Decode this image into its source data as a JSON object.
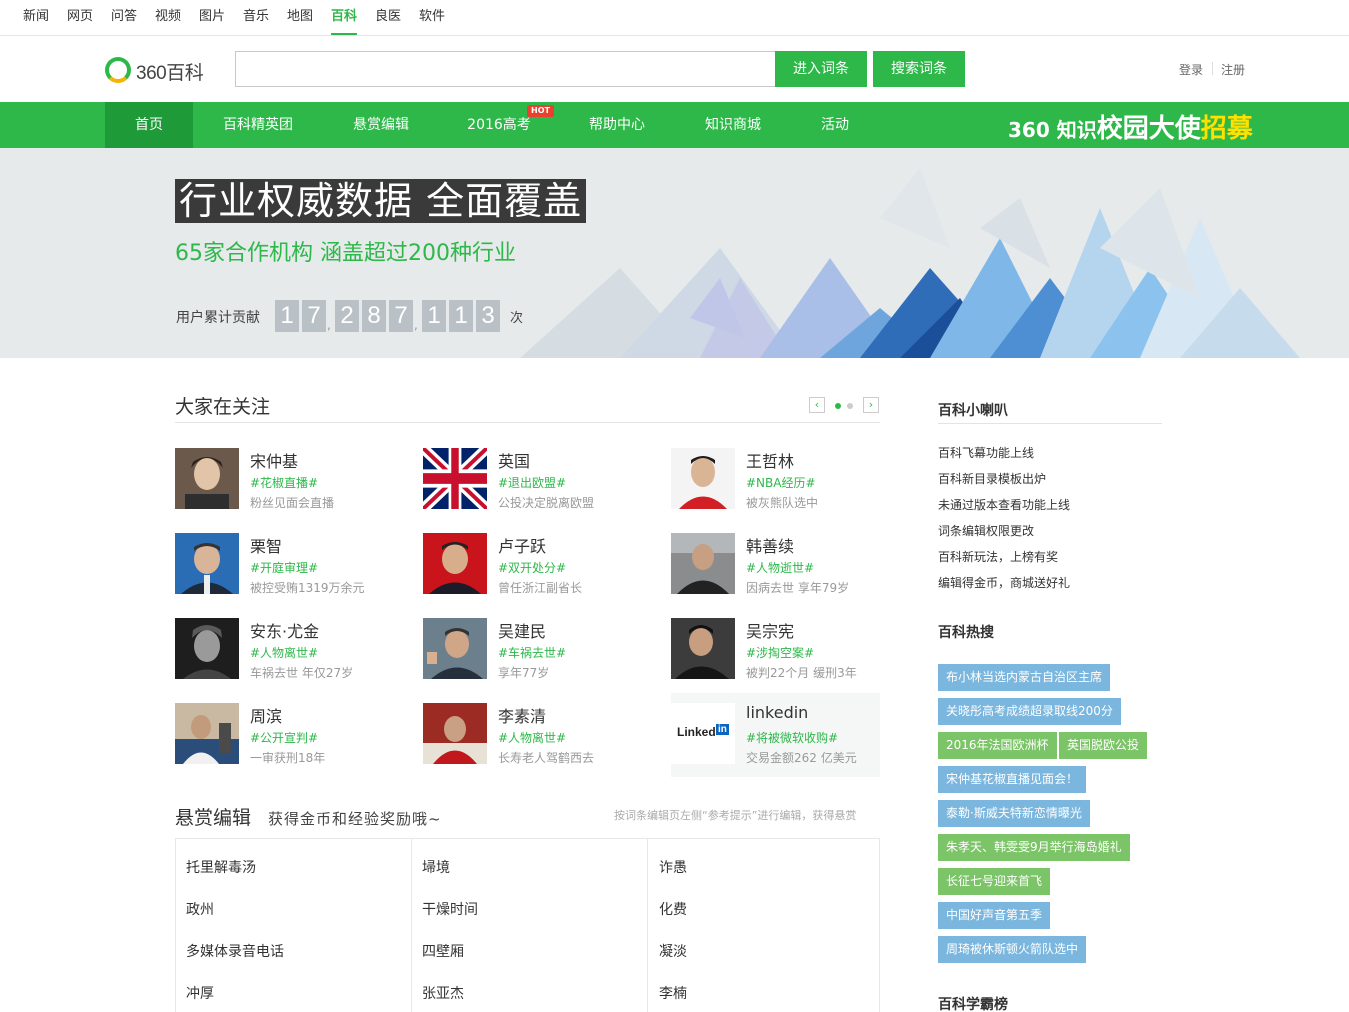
{
  "topnav": {
    "items": [
      "新闻",
      "网页",
      "问答",
      "视频",
      "图片",
      "音乐",
      "地图",
      "百科",
      "良医",
      "软件"
    ],
    "active": "百科"
  },
  "header": {
    "logo_text": "360百科",
    "search_value": "",
    "enter_button": "进入词条",
    "search_button": "搜索词条",
    "login": "登录",
    "register": "注册"
  },
  "mainnav": {
    "items": [
      "首页",
      "百科精英团",
      "悬赏编辑",
      "2016高考",
      "帮助中心",
      "知识商城",
      "活动"
    ],
    "hot_badge": "HOT",
    "promo_part1": "360 知识",
    "promo_part2": "校园大使",
    "promo_part3": "招募"
  },
  "banner": {
    "headline": "行业权威数据 全面覆盖",
    "subline": "65家合作机构  涵盖超过200种行业",
    "contrib_label": "用户累计贡献",
    "digits": [
      "1",
      "7",
      "2",
      "8",
      "7",
      "1",
      "1",
      "3"
    ],
    "times_label": "次"
  },
  "focus": {
    "title": "大家在关注",
    "people": [
      {
        "name": "宋仲基",
        "tag": "#花椒直播#",
        "desc": "粉丝见面会直播"
      },
      {
        "name": "英国",
        "tag": "#退出欧盟#",
        "desc": "公投决定脱离欧盟"
      },
      {
        "name": "王哲林",
        "tag": "#NBA经历#",
        "desc": "被灰熊队选中"
      },
      {
        "name": "栗智",
        "tag": "#开庭审理#",
        "desc": "被控受贿1319万余元"
      },
      {
        "name": "卢子跃",
        "tag": "#双开处分#",
        "desc": "曾任浙江副省长"
      },
      {
        "name": "韩善续",
        "tag": "#人物逝世#",
        "desc": "因病去世 享年79岁"
      },
      {
        "name": "安东·尤金",
        "tag": "#人物离世#",
        "desc": "车祸去世 年仅27岁"
      },
      {
        "name": "吴建民",
        "tag": "#车祸去世#",
        "desc": "享年77岁"
      },
      {
        "name": "吴宗宪",
        "tag": "#涉掏空案#",
        "desc": "被判22个月 缓刑3年"
      },
      {
        "name": "周滨",
        "tag": "#公开宣判#",
        "desc": "一审获刑18年"
      },
      {
        "name": "李素清",
        "tag": "#人物离世#",
        "desc": "长寿老人驾鹤西去"
      },
      {
        "name": "linkedin",
        "tag": "#将被微软收购#",
        "desc": "交易金额262 亿美元"
      }
    ],
    "linkedin_logo": "Linked in"
  },
  "bounty": {
    "title": "悬赏编辑",
    "subtitle": "获得金币和经验奖励哦~",
    "hint": "按词条编辑页左侧“参考提示”进行编辑，获得悬赏",
    "columns": [
      [
        "托里解毒汤",
        "政州",
        "多媒体录音电话",
        "冲厚"
      ],
      [
        "埽境",
        "干燥时间",
        "四壁厢",
        "张亚杰"
      ],
      [
        "诈愚",
        "化费",
        "凝淡",
        "李楠"
      ]
    ]
  },
  "sidebar": {
    "news_title": "百科小喇叭",
    "news": [
      "百科飞幕功能上线",
      "百科新目录模板出炉",
      "未通过版本查看功能上线",
      "词条编辑权限更改",
      "百科新玩法，上榜有奖",
      "编辑得金币，商城送好礼"
    ],
    "hot_title": "百科热搜",
    "hot_tags": [
      "布小林当选内蒙古自治区主席",
      "关晓彤高考成绩超录取线200分",
      "2016年法国欧洲杯",
      "英国脱欧公投",
      "宋仲基花椒直播见面会！",
      "泰勒·斯威夫特新恋情曝光",
      "朱孝天、韩雯雯9月举行海岛婚礼",
      "长征七号迎来首飞",
      "中国好声音第五季",
      "周琦被休斯顿火箭队选中"
    ],
    "rank_title": "百科学霸榜"
  },
  "colors": {
    "brand_green": "#2eb84a",
    "hot_blue": "#7ab6dd",
    "hot_green": "#7cc468"
  }
}
